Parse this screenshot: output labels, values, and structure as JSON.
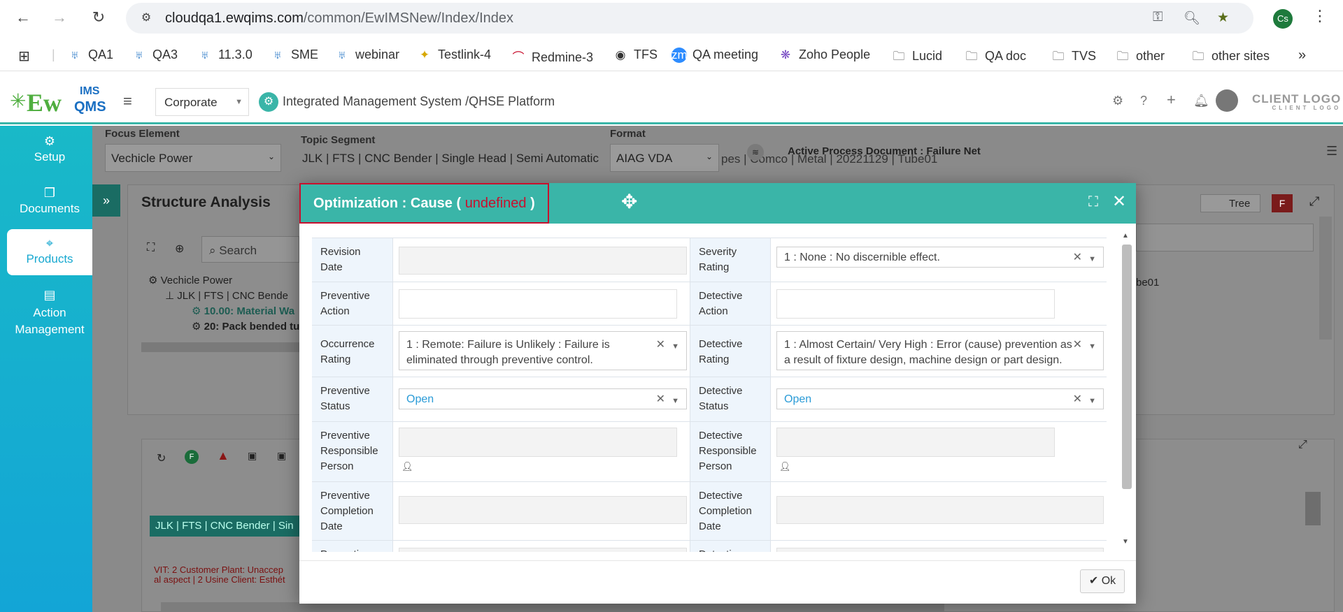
{
  "browser": {
    "url_domain": "cloudqa1.ewqims.com",
    "url_path": "/common/EwIMSNew/Index/Index",
    "profile_initials": "Cs",
    "bookmarks": [
      "QA1",
      "QA3",
      "11.3.0",
      "SME",
      "webinar",
      "Testlink-4",
      "Redmine-3",
      "TFS",
      "QA meeting",
      "Zoho People",
      "Lucid",
      "QA doc",
      "TVS",
      "other",
      "other sites"
    ]
  },
  "header": {
    "logo_text": "Ew",
    "logo_sub": "QMS",
    "logo_ims": "IMS",
    "corporate": "Corporate",
    "title": "Integrated Management System /QHSE Platform",
    "client_logo": "CLIENT LOGO",
    "client_logo_sub": "CLIENT LOGO"
  },
  "sidebar": {
    "items": [
      {
        "label": "Setup",
        "icon": "gears-icon"
      },
      {
        "label": "Documents",
        "icon": "copy-icon"
      },
      {
        "label": "Products",
        "icon": "box-icon"
      },
      {
        "label": "Action Management",
        "icon": "building-icon"
      }
    ]
  },
  "filters": {
    "focus_label": "Focus Element",
    "focus_value": "Vechicle Power",
    "topic_label": "Topic Segment",
    "topic_value": "JLK | FTS | CNC Bender | Single Head | Semi Automatic",
    "topic_tail": "pes | Comco | Metal | 20221129 | Tube01",
    "format_label": "Format",
    "format_value": "AIAG VDA",
    "active_doc": "Active Process Document : Failure Net"
  },
  "structure": {
    "title": "Structure Analysis",
    "search_placeholder": "Search",
    "tree": [
      "Vechicle Power",
      "JLK | FTS | CNC Bende",
      "10.00: Material Wa",
      "20: Pack bended tu"
    ],
    "tree_toggle": "Tree",
    "badge": "F",
    "right_text": "be01"
  },
  "lower": {
    "node": "JLK | FTS | CNC Bender | Sin",
    "red_text_1": "VIT: 2 Customer Plant: Unaccep",
    "red_text_2": "al aspect | 2 Usine Client: Esthét"
  },
  "modal": {
    "title_prefix": "Optimization : Cause ( ",
    "title_undefined": "undefined",
    "title_suffix": " )",
    "ok_label": "Ok",
    "rows": {
      "revision_date": "Revision Date",
      "severity_rating": "Severity Rating",
      "severity_value": "1 : None : No discernible effect.",
      "preventive_action": "Preventive Action",
      "detective_action": "Detective Action",
      "occurrence_rating": "Occurrence Rating",
      "occurrence_value": "1 : Remote: Failure is Unlikely : Failure is eliminated through preventive control.",
      "detective_rating": "Detective Rating",
      "detective_value": "1 : Almost Certain/ Very High : Error (cause) prevention as a result of fixture design, machine design or part design.",
      "preventive_status": "Preventive Status",
      "preventive_status_value": "Open",
      "detective_status": "Detective Status",
      "detective_status_value": "Open",
      "preventive_resp": "Preventive Responsible Person",
      "detective_resp": "Detective Responsible Person",
      "preventive_completion": "Preventive Completion Date",
      "detective_completion": "Detective Completion Date",
      "preventive_cut": "Preventive",
      "detective_cut": "Detective"
    }
  }
}
